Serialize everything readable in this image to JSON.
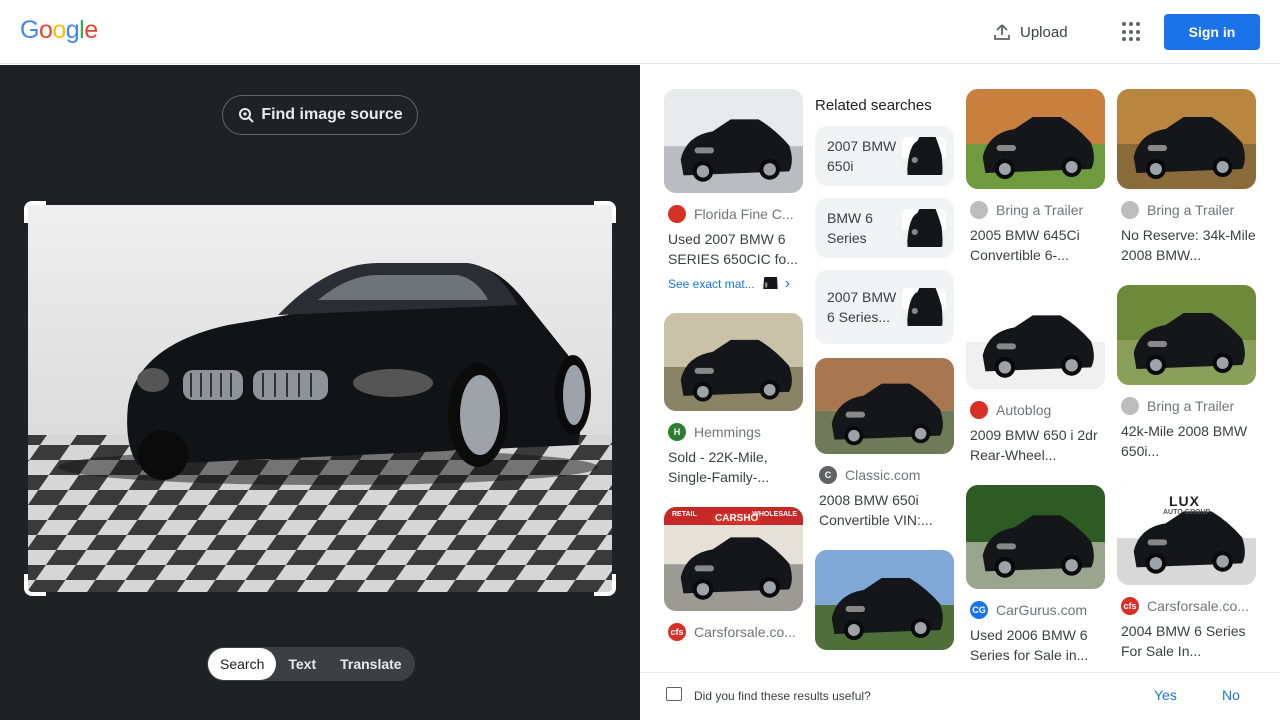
{
  "header": {
    "logo_letters": [
      {
        "ch": "G",
        "color": "#4285f4"
      },
      {
        "ch": "o",
        "color": "#ea4335"
      },
      {
        "ch": "o",
        "color": "#fbbc05"
      },
      {
        "ch": "g",
        "color": "#4285f4"
      },
      {
        "ch": "l",
        "color": "#34a853"
      },
      {
        "ch": "e",
        "color": "#ea4335"
      }
    ],
    "upload_label": "Upload",
    "upload_icon": "upload-icon",
    "apps_icon": "apps-grid-icon",
    "sign_in_label": "Sign in"
  },
  "lens": {
    "find_source_label": "Find image source",
    "modes": [
      "Search",
      "Text",
      "Translate"
    ],
    "active_mode": "Search"
  },
  "results": {
    "col1": [
      {
        "source": "Florida Fine C...",
        "favicon_color": "#d93025",
        "title": "Used 2007 BMW 6 SERIES 650CIC fo...",
        "exact_match": "See exact mat...",
        "thumb_h": 104,
        "scene": "studio"
      },
      {
        "source": "Hemmings",
        "favicon_color": "#2e7d32",
        "favicon_text": "H",
        "title": "Sold - 22K-Mile, Single-Family-...",
        "thumb_h": 98,
        "scene": "field"
      },
      {
        "source": "Carsforsale.co...",
        "favicon_color": "#d93025",
        "favicon_text": "cfs",
        "title": "",
        "thumb_h": 104,
        "scene": "lot",
        "badge_left": "RETAIL",
        "badge_mid": "CARSHO",
        "badge_right": "WHOLESALE"
      }
    ],
    "related_heading": "Related searches",
    "related": [
      {
        "label": "2007 BMW 650i"
      },
      {
        "label": "BMW 6 Series"
      },
      {
        "label": "2007 BMW 6 Series..."
      }
    ],
    "col2": [
      {
        "source": "Classic.com",
        "favicon_color": "#5f6368",
        "favicon_text": "C",
        "title": "2008 BMW 650i Convertible VIN:...",
        "thumb_h": 96,
        "scene": "house"
      },
      {
        "source": "",
        "title": "",
        "thumb_h": 100,
        "scene": "palms"
      }
    ],
    "col3": [
      {
        "source": "Bring a Trailer",
        "favicon_color": "#bdbdbd",
        "title": "2005 BMW 645Ci Convertible 6-...",
        "thumb_h": 100,
        "scene": "grass"
      },
      {
        "source": "Autoblog",
        "favicon_color": "#d93025",
        "title": "2009 BMW 650 i 2dr Rear-Wheel...",
        "thumb_h": 104,
        "scene": "white"
      },
      {
        "source": "CarGurus.com",
        "favicon_color": "#1a73e8",
        "favicon_text": "CG",
        "title": "Used 2006 BMW 6 Series for Sale in...",
        "thumb_h": 104,
        "scene": "bushes"
      }
    ],
    "col4": [
      {
        "source": "Bring a Trailer",
        "favicon_color": "#bdbdbd",
        "title": "No Reserve: 34k-Mile 2008 BMW...",
        "thumb_h": 100,
        "scene": "autumn"
      },
      {
        "source": "Bring a Trailer",
        "favicon_color": "#bdbdbd",
        "title": "42k-Mile 2008 BMW 650i...",
        "thumb_h": 100,
        "scene": "grass2"
      },
      {
        "source": "Carsforsale.co...",
        "favicon_color": "#d93025",
        "favicon_text": "cfs",
        "title": "2004 BMW 6 Series For Sale In...",
        "thumb_h": 104,
        "scene": "showroom",
        "badge_brand": "LUX",
        "badge_sub": "AUTO GROUP"
      }
    ]
  },
  "feedback": {
    "question": "Did you find these results useful?",
    "yes": "Yes",
    "no": "No"
  }
}
